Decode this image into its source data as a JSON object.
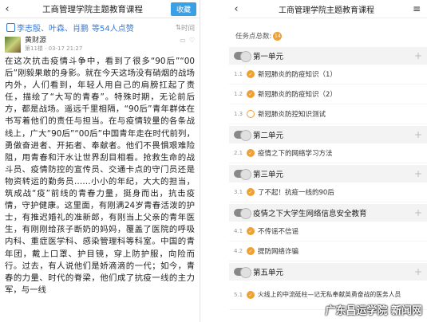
{
  "left": {
    "back_icon": "chevron-left-icon",
    "title": "工商管理学院主题教育课程",
    "collect_label": "收藏",
    "likes_names": "李志殷、叶森、肖鹏",
    "likes_count": "等54人点赞",
    "time_label": "时间",
    "author_name": "黄财源",
    "author_floor": "第11楼 · 03-17 21:27",
    "post_text": "在这次抗击疫情斗争中，看到了很多“90后”“00后”刚毅果敢的身影。就在今天这场没有硝烟的战场内外，人们看到，年轻人用自己的肩膀扛起了责任，描绘了“大写的青春”。特殊时期，无论前后方，都是战场。遥远千里相隔，“90后”青年群体在书写着他们的责任与担当。在与疫情较量的各条战线上，广大“90后”“00后”中国青年走在时代前列，勇做奋进者、开拓者、奉献者。他们不畏惧艰难险阻，用青春和汗水让世界刮目相看。抢救生命的战斗员、疫情防控的宣传员、交通卡点的守门员还是物资转运的勤务员……小小的年纪，大大的担当，筑成战“疫”前线的青春力量，挺身而出，抗击疫情，守护健康。这里面，有刚满24岁青春活泼的护士，有推迟婚礼的准新郎，有刚当上父亲的青年医生，有刚刚给孩子断奶的妈妈，覆盖了医院的呼吸内科、重症医学科、感染管理科等科室。中国的青年团，戴上口罩、护目镜，穿上防护服，向险而行。过去，有人说他们是娇滴滴的一代；如今，青春的力量、时代的脊梁，他们成了抗疫一线的主力军，与一线"
  },
  "right": {
    "back_icon": "chevron-left-icon",
    "title": "工商管理学院主题教育课程",
    "menu_icon": "hamburger-menu-icon",
    "task_label": "任务点总数:",
    "task_count": "14",
    "units": [
      {
        "title": "第一单元",
        "items": [
          {
            "num": "1.1",
            "title": "新冠肺炎的防疫知识（1）",
            "done": true
          },
          {
            "num": "1.2",
            "title": "新冠肺炎的防疫知识（2）",
            "done": true
          },
          {
            "num": "1.3",
            "title": "新冠肺炎防控知识测试",
            "done": false
          }
        ]
      },
      {
        "title": "第二单元",
        "items": [
          {
            "num": "2.1",
            "title": "疫情之下的网络学习方法",
            "done": true
          }
        ]
      },
      {
        "title": "第三单元",
        "items": [
          {
            "num": "3.1",
            "title": "了不起！抗疫一线的90后",
            "done": true
          }
        ]
      },
      {
        "title": "疫情之下大学生网络信息安全教育",
        "items": [
          {
            "num": "4.1",
            "title": "不传谣不信谣",
            "done": true
          },
          {
            "num": "4.2",
            "title": "提防网络诈骗",
            "done": true
          }
        ]
      },
      {
        "title": "第五单元",
        "items": [
          {
            "num": "5.1",
            "title": "火线上的中流砥柱—记无私奉献英勇奋战的医务人员",
            "done": true
          }
        ]
      }
    ],
    "watermark": "广东昌运学院 新闻网",
    "accent": "#f0a030",
    "link_color": "#3a7bd5"
  }
}
